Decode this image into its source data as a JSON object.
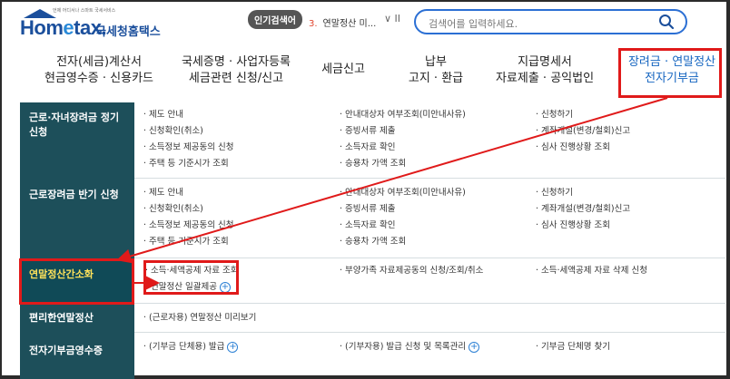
{
  "header": {
    "logo_tagline": "언제 어디서나 스마트 국세서비스",
    "logo_brand_a": "Hom",
    "logo_brand_e": "e",
    "logo_brand_b": "tax.",
    "logo_korean": "국세청홈택스",
    "popular_badge": "인기검색어",
    "popular_num": "3.",
    "popular_text": "연말정산 미...",
    "popular_controls": "∨  II",
    "search_placeholder": "검색어를 입력하세요."
  },
  "nav": [
    {
      "line1": "전자(세금)계산서",
      "line2": "현금영수증 · 신용카드"
    },
    {
      "line1": "국세증명 · 사업자등록",
      "line2": "세금관련 신청/신고"
    },
    {
      "line1": "세금신고",
      "line2": ""
    },
    {
      "line1": "납부",
      "line2": "고지 · 환급"
    },
    {
      "line1": "지급명세서",
      "line2": "자료제출 · 공익법인"
    },
    {
      "line1": "장려금 · 연말정산",
      "line2": "전자기부금"
    }
  ],
  "rows": [
    {
      "title": "근로·자녀장려금 정기 신청",
      "col1": [
        "· 제도 안내",
        "· 신청확인(취소)",
        "· 소득정보 제공동의 신청",
        "· 주택 등 기준시가 조회"
      ],
      "col2": [
        "· 안내대상자 여부조회(미안내사유)",
        "· 증빙서류 제출",
        "· 소득자료 확인",
        "· 승용차 가액 조회"
      ],
      "col3": [
        "· 신청하기",
        "· 계좌개설(변경/철회)신고",
        "· 심사 진행상황 조회"
      ]
    },
    {
      "title": "근로장려금 반기 신청",
      "col1": [
        "· 제도 안내",
        "· 신청확인(취소)",
        "· 소득정보 제공동의 신청",
        "· 주택 등 기준시가 조회"
      ],
      "col2": [
        "· 안내대상자 여부조회(미안내사유)",
        "· 증빙서류 제출",
        "· 소득자료 확인",
        "· 승용차 가액 조회"
      ],
      "col3": [
        "· 신청하기",
        "· 계좌개설(변경/철회)신고",
        "· 심사 진행상황 조회"
      ]
    },
    {
      "title": "연말정산간소화",
      "col1": [
        "· 소득·세액공제 자료 조회",
        "· 연말정산 일괄제공"
      ],
      "col2": [
        "· 부양가족 자료제공동의 신청/조회/취소"
      ],
      "col3": [
        "· 소득·세액공제 자료 삭제 신청"
      ]
    },
    {
      "title": "편리한연말정산",
      "col1": [
        "· (근로자용) 연말정산 미리보기"
      ],
      "col2": [],
      "col3": []
    },
    {
      "title": "전자기부금영수증",
      "col1": [
        "· (기부금 단체용) 발급"
      ],
      "col2": [
        "· (기부자용) 발급 신청 및 목록관리"
      ],
      "col3": [
        "· 기부금 단체명 찾기"
      ]
    }
  ],
  "colors": {
    "accent": "#1565c0",
    "row_header": "#1d4f5a",
    "highlight_text": "#ffe25a",
    "annotation": "#e01a1a"
  }
}
